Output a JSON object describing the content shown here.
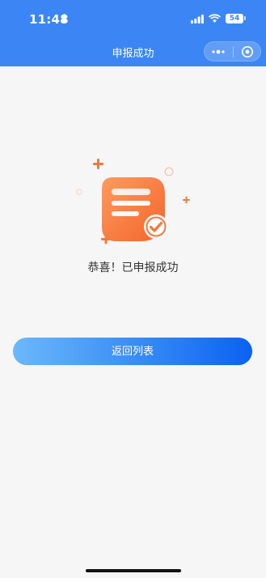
{
  "status_bar": {
    "time": "11:48",
    "battery": "54"
  },
  "nav": {
    "title": "申报成功"
  },
  "main": {
    "message": "恭喜！已申报成功",
    "back_button_label": "返回列表"
  },
  "colors": {
    "header_bg": "#3b86f4",
    "accent_orange": "#f57b3e",
    "button_start": "#6cb8fb",
    "button_end": "#0a62f2"
  }
}
